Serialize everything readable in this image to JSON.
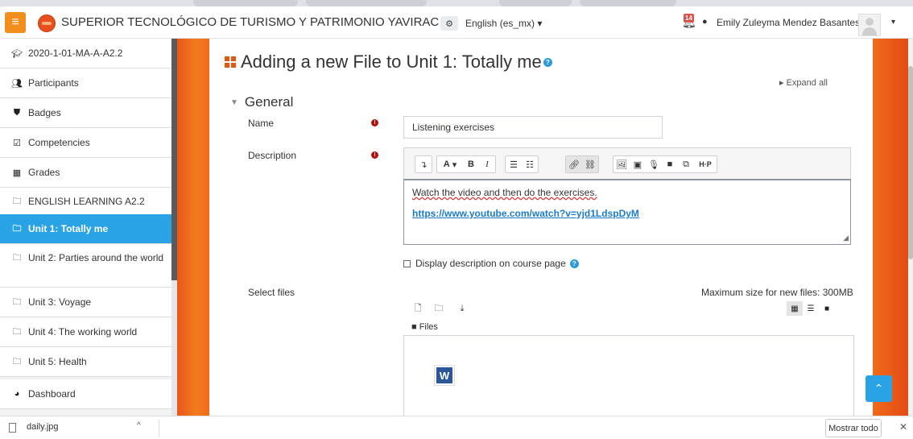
{
  "navbar": {
    "site_name": "SUPERIOR TECNOLÓGICO DE TURISMO Y PATRIMONIO YAVIRAC",
    "language": "English (es_mx) ▾",
    "notification_count": "14",
    "user_name": "Emily Zuleyma Mendez Basantes"
  },
  "drawer": {
    "items": [
      {
        "label": "2020-1-01-MA-A-A2.2",
        "icon": "graduation-cap-icon"
      },
      {
        "label": "Participants",
        "icon": "users-icon"
      },
      {
        "label": "Badges",
        "icon": "shield-icon"
      },
      {
        "label": "Competencies",
        "icon": "checkbox-icon"
      },
      {
        "label": "Grades",
        "icon": "table-icon"
      },
      {
        "label": "ENGLISH LEARNING A2.2",
        "icon": "folder-icon"
      },
      {
        "label": "Unit 1: Totally me",
        "icon": "folder-icon",
        "active": true
      },
      {
        "label": "Unit 2: Parties around the world",
        "icon": "folder-icon"
      },
      {
        "label": "Unit 3: Voyage",
        "icon": "folder-icon"
      },
      {
        "label": "Unit 4: The working world",
        "icon": "folder-icon"
      },
      {
        "label": "Unit 5: Health",
        "icon": "folder-icon"
      },
      {
        "label": "Dashboard",
        "icon": "dashboard-icon"
      }
    ]
  },
  "page": {
    "title": "Adding a new File to Unit 1: Totally me",
    "expand_all": "Expand all",
    "section_title": "General"
  },
  "form": {
    "name_label": "Name",
    "name_value": "Listening exercises",
    "description_label": "Description",
    "description_line1": "Watch the video and then do the exercises.",
    "description_link": "https://www.youtube.com/watch?v=yjd1LdspDyM",
    "display_description_label": "Display description on course page",
    "select_files_label": "Select files",
    "max_size": "Maximum size for new files: 300MB",
    "files_path": "Files"
  },
  "download_bar": {
    "file_name": "daily.jpg",
    "show_all": "Mostrar todo"
  },
  "colors": {
    "accent_blue": "#29a3e6",
    "orange": "#f28e1c",
    "required_red": "#b40f0f"
  }
}
